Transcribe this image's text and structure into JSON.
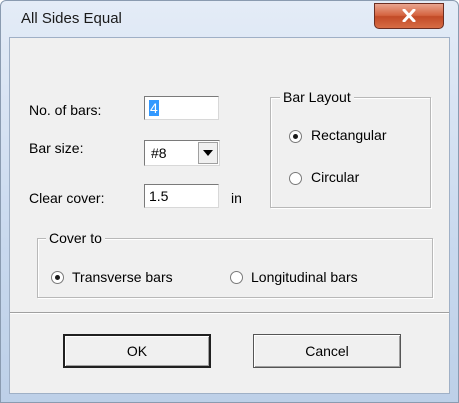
{
  "window": {
    "title": "All Sides Equal",
    "close_glyph": "X"
  },
  "fields": {
    "num_bars_label": "No. of bars:",
    "num_bars_value": "4",
    "bar_size_label": "Bar size:",
    "bar_size_value": "#8",
    "clear_cover_label": "Clear cover:",
    "clear_cover_value": "1.5",
    "clear_cover_unit": "in"
  },
  "bar_layout": {
    "title": "Bar Layout",
    "options": [
      {
        "label": "Rectangular",
        "selected": true
      },
      {
        "label": "Circular",
        "selected": false
      }
    ]
  },
  "cover_to": {
    "title": "Cover to",
    "options": [
      {
        "label": "Transverse bars",
        "selected": true
      },
      {
        "label": "Longitudinal bars",
        "selected": false
      }
    ]
  },
  "buttons": {
    "ok": "OK",
    "cancel": "Cancel"
  },
  "colors": {
    "close_red": "#c24a27",
    "selection": "#3399ff",
    "face": "#f0f0f0"
  }
}
